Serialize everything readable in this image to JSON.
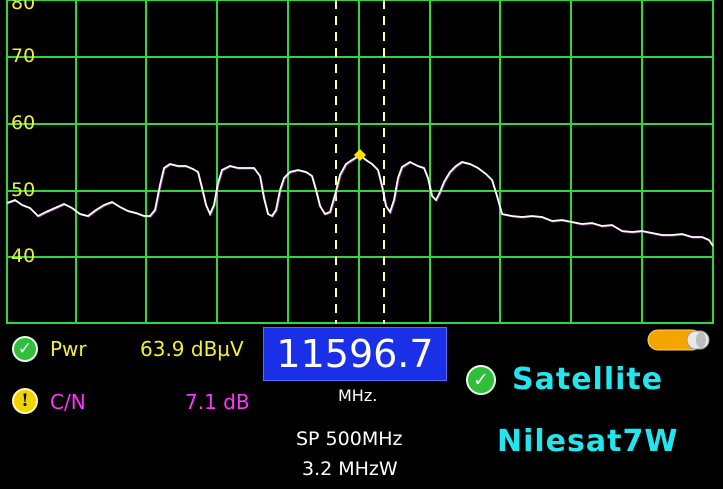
{
  "spectrum": {
    "y_axis_ticks": [
      "80",
      "70",
      "60",
      "50",
      "40"
    ],
    "trace_color": "#ffffff",
    "grid_color": "#2ed83a",
    "marker_line_color": "#ffffa0",
    "marker_color": "#ffe000"
  },
  "readings": {
    "pwr_label": "Pwr",
    "pwr_value": "63.9 dBµV",
    "pwr_status_icon": "check-icon",
    "cn_label": "C/N",
    "cn_value": "7.1 dB",
    "cn_status_icon": "exclamation-icon"
  },
  "frequency": {
    "value": "11596.7",
    "unit": "MHz.",
    "span": "SP 500MHz",
    "rbw": "3.2 MHzW"
  },
  "satellite": {
    "status_icon": "check-icon",
    "label": "Satellite",
    "name": "Nilesat7W"
  },
  "battery": {
    "icon": "battery-icon",
    "color": "#f5a400"
  }
}
